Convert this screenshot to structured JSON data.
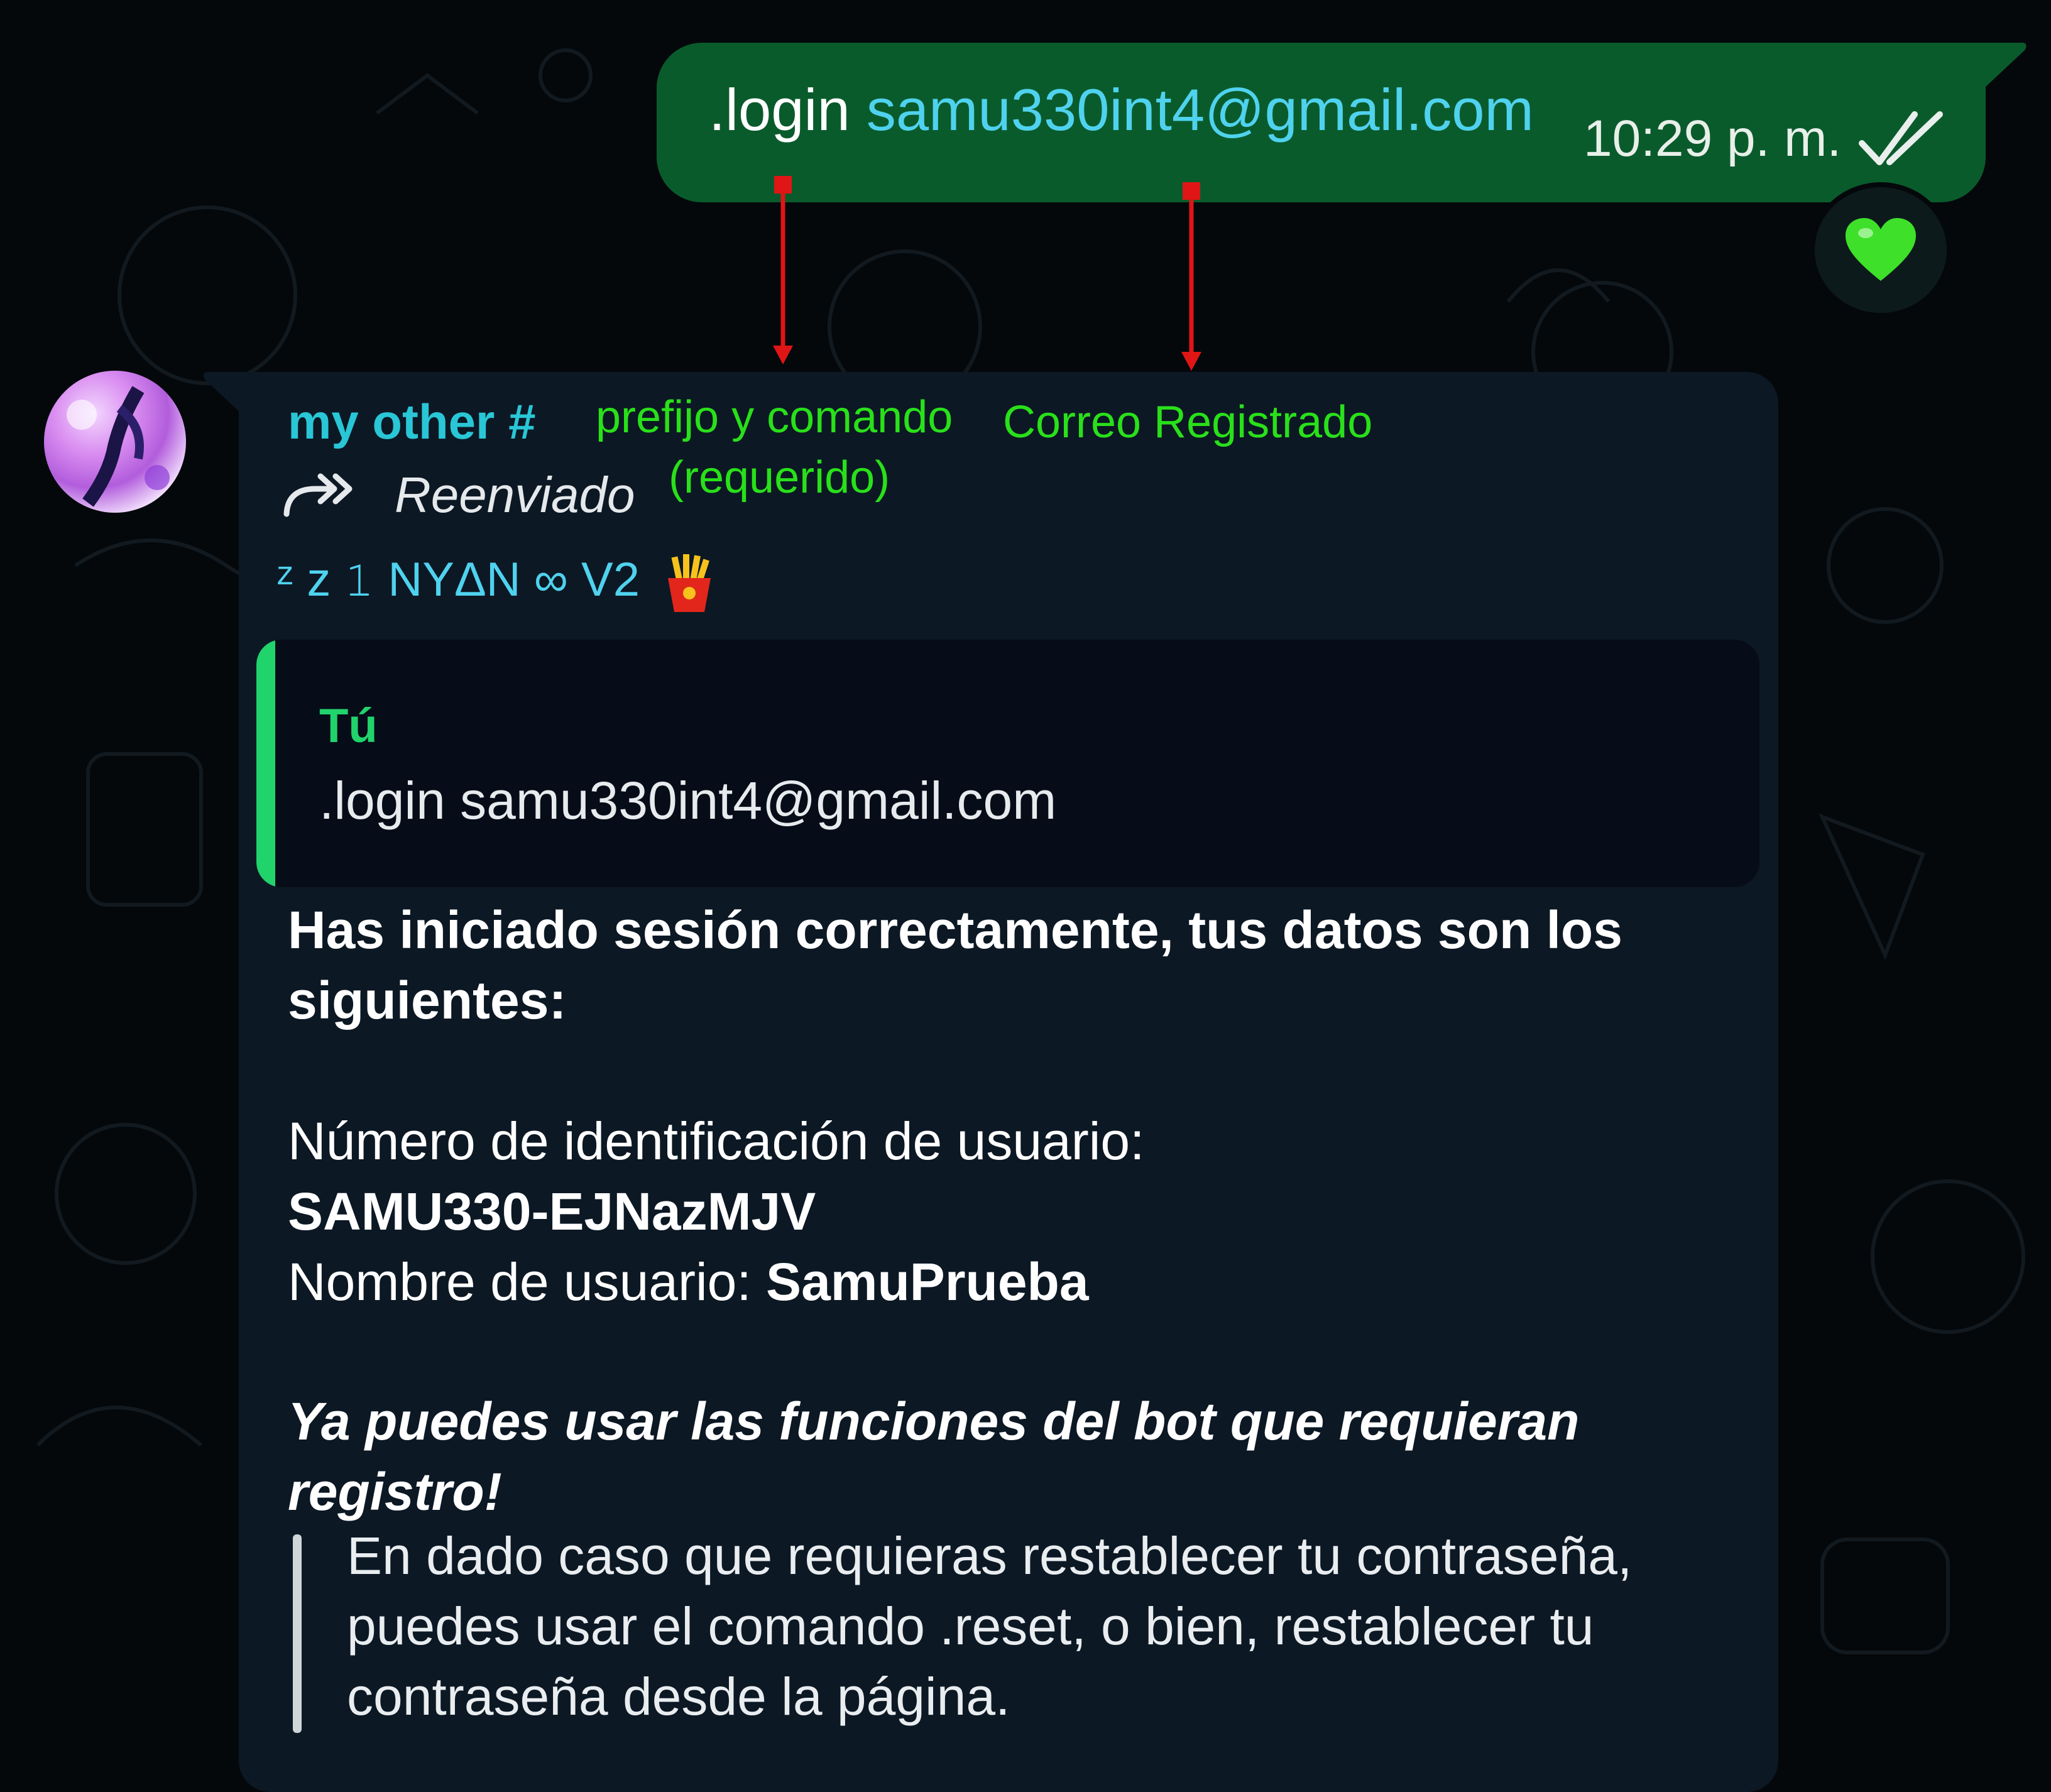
{
  "outgoing_message": {
    "command": ".login",
    "email": "samu330int4@gmail.com",
    "time": "10:29 p. m.",
    "status_icon": "double-check-icon",
    "reaction": "green-heart-emoji"
  },
  "annotations": {
    "prefix_label_line1": "prefijo y comando",
    "prefix_label_line2": "(requerido)",
    "email_label": "Correo Registrado",
    "color": "#29e01a",
    "arrow_color": "#e01515"
  },
  "incoming_message": {
    "sender": "my other #",
    "forwarded_label": "Reenviado",
    "push_name": "ᶻ z 𝟷 NYΔN ∞ V2",
    "push_name_emoji": "fries-emoji",
    "quoted": {
      "author": "Tú",
      "text": ".login samu330int4@gmail.com"
    },
    "success_text": "Has iniciado sesión correctamente, tus datos son los siguientes:",
    "user_id_label": "Número de identificación de usuario:",
    "user_id_value": "SAMU330-EJNazMJV",
    "username_label": "Nombre de usuario: ",
    "username_value": "SamuPrueba",
    "ready_text": "Ya puedes usar las funciones del bot que requieran registro!",
    "reset_note": "En dado caso que requieras restablecer tu contraseña, puedes usar el comando .reset, o bien, restablecer tu contraseña desde la página."
  },
  "colors": {
    "outgoing_bubble": "#0a5b2c",
    "incoming_bubble": "#0c1824",
    "email_highlight": "#4fd2ee",
    "sender_name": "#29c6d6",
    "quote_accent": "#21d36b",
    "background": "#04080b"
  }
}
